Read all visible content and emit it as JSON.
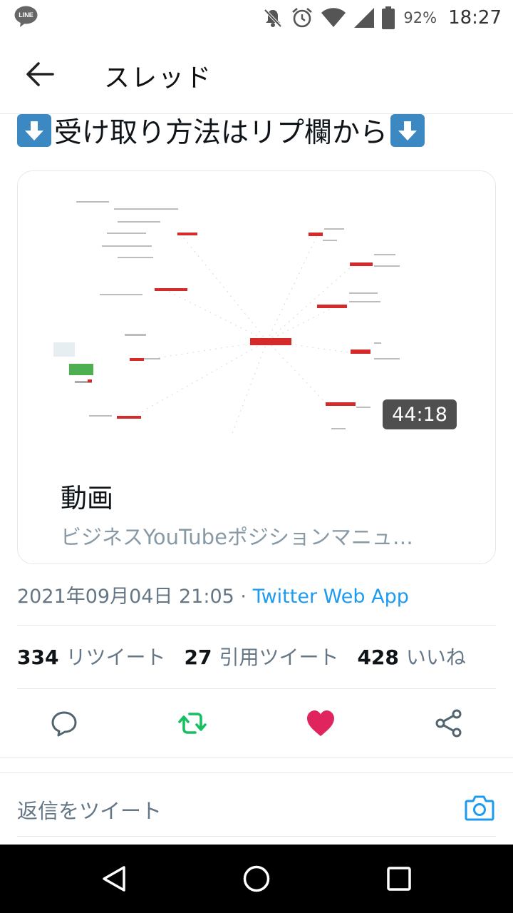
{
  "status_bar": {
    "notification_app_icon": "line-icon",
    "line_icon_text": "LINE",
    "icons": [
      "notifications-off-icon",
      "alarm-icon",
      "wifi-icon",
      "signal-icon",
      "battery-icon"
    ],
    "battery_percent": "92%",
    "time": "18:27"
  },
  "header": {
    "back_icon": "arrow-left-icon",
    "title": "スレッド"
  },
  "tweet": {
    "text": "受け取り方法はリプ欄から",
    "emoji": "down-arrow-emoji",
    "media": {
      "thumbnail": "mind-map-image",
      "duration": "44:18",
      "title": "動画",
      "description": "ビジネスYouTubeポジションマニュ…"
    },
    "timestamp": "2021年09月04日 21:05",
    "separator": " · ",
    "source": "Twitter Web App",
    "stats": {
      "retweets_count": "334",
      "retweets_label": "リツイート",
      "quotes_count": "27",
      "quotes_label": "引用ツイート",
      "likes_count": "428",
      "likes_label": "いいね"
    },
    "actions": {
      "reply_icon": "reply-icon",
      "retweet_icon": "retweet-icon",
      "like_icon": "heart-icon",
      "share_icon": "share-icon",
      "retweet_color": "#17bf63",
      "like_color": "#e0245e"
    }
  },
  "reply_bar": {
    "placeholder": "返信をツイート",
    "camera_icon": "camera-icon",
    "accent": "#1d9bf0"
  },
  "nav_bar": {
    "icons": [
      "back-triangle-icon",
      "home-circle-icon",
      "recents-square-icon"
    ]
  }
}
